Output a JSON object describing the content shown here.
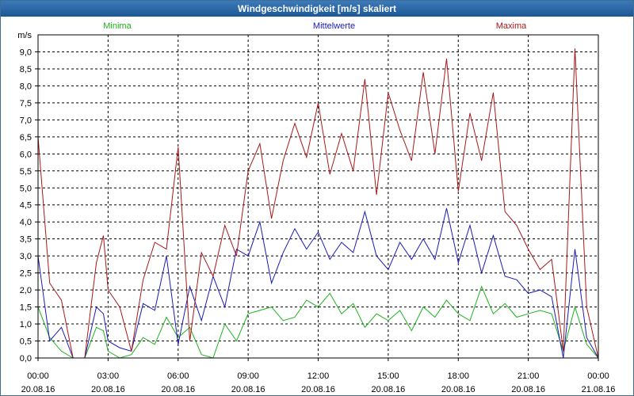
{
  "window": {
    "title": "Windgeschwindigkeit [m/s] skaliert"
  },
  "chart_data": {
    "type": "line",
    "title": "Windgeschwindigkeit [m/s] skaliert",
    "ylabel": "m/s",
    "xlabel": "",
    "ylim": [
      0,
      9.5
    ],
    "xlim": [
      0,
      24
    ],
    "grid": true,
    "legend_placement": "top",
    "yticks": [
      "0,0",
      "0,5",
      "1,0",
      "1,5",
      "2,0",
      "2,5",
      "3,0",
      "3,5",
      "4,0",
      "4,5",
      "5,0",
      "5,5",
      "6,0",
      "6,5",
      "7,0",
      "7,5",
      "8,0",
      "8,5",
      "9,0"
    ],
    "xticks": [
      {
        "time": "00:00",
        "date": "20.08.16"
      },
      {
        "time": "03:00",
        "date": "20.08.16"
      },
      {
        "time": "06:00",
        "date": "20.08.16"
      },
      {
        "time": "09:00",
        "date": "20.08.16"
      },
      {
        "time": "12:00",
        "date": "20.08.16"
      },
      {
        "time": "15:00",
        "date": "20.08.16"
      },
      {
        "time": "18:00",
        "date": "20.08.16"
      },
      {
        "time": "21:00",
        "date": "20.08.16"
      },
      {
        "time": "00:00",
        "date": "21.08.16"
      }
    ],
    "series": [
      {
        "name": "Minima",
        "color": "#1fb21f",
        "x": [
          0,
          0.5,
          1,
          1.5,
          2,
          2.5,
          2.8,
          3,
          3.5,
          4,
          4.5,
          5,
          5.5,
          6,
          6.5,
          7,
          7.5,
          8,
          8.5,
          9,
          9.5,
          10,
          10.5,
          11,
          11.5,
          12,
          12.5,
          13,
          13.5,
          14,
          14.5,
          15,
          15.5,
          16,
          16.5,
          17,
          17.5,
          18,
          18.5,
          19,
          19.5,
          20,
          20.5,
          21,
          21.5,
          22,
          22.5,
          23,
          23.5,
          24
        ],
        "y": [
          1.5,
          0.6,
          0.2,
          0,
          0,
          0.9,
          0.8,
          0.2,
          0,
          0.1,
          0.6,
          0.4,
          1.2,
          0.6,
          0.9,
          0.1,
          0,
          1,
          0.5,
          1.3,
          1.4,
          1.5,
          1.1,
          1.2,
          1.7,
          1.5,
          1.9,
          1.3,
          1.6,
          0.9,
          1.3,
          1.1,
          1.4,
          0.8,
          1.5,
          1.2,
          1.7,
          1.3,
          1.1,
          2.1,
          1.3,
          1.6,
          1.2,
          1.3,
          1.4,
          1.3,
          0.2,
          1.5,
          0.4,
          0
        ]
      },
      {
        "name": "Mittelwerte",
        "color": "#1a1ab8",
        "x": [
          0,
          0.5,
          1,
          1.5,
          2,
          2.5,
          2.8,
          3,
          3.5,
          4,
          4.5,
          5,
          5.5,
          6,
          6.5,
          7,
          7.5,
          8,
          8.5,
          9,
          9.5,
          10,
          10.5,
          11,
          11.5,
          12,
          12.5,
          13,
          13.5,
          14,
          14.5,
          15,
          15.5,
          16,
          16.5,
          17,
          17.5,
          18,
          18.5,
          19,
          19.5,
          20,
          20.5,
          21,
          21.5,
          22,
          22.5,
          23,
          23.5,
          24
        ],
        "y": [
          3.0,
          0.5,
          0.9,
          0,
          0,
          1.5,
          1.3,
          0.5,
          0.3,
          0.2,
          1.6,
          1.4,
          3.0,
          0.4,
          2.1,
          1.1,
          2.4,
          1.5,
          3.2,
          3.0,
          4.0,
          2.2,
          3.1,
          3.8,
          3.2,
          3.7,
          2.9,
          3.4,
          3.1,
          4.3,
          3.0,
          2.6,
          3.4,
          2.9,
          3.5,
          2.9,
          4.4,
          2.8,
          3.9,
          2.5,
          3.6,
          2.4,
          2.3,
          1.9,
          2.0,
          1.8,
          0,
          3.2,
          0.6,
          0
        ]
      },
      {
        "name": "Maxima",
        "color": "#a81818",
        "x": [
          0,
          0.5,
          1,
          1.5,
          2,
          2.5,
          2.8,
          3,
          3.5,
          4,
          4.5,
          5,
          5.5,
          6,
          6.5,
          7,
          7.5,
          8,
          8.5,
          9,
          9.5,
          10,
          10.5,
          11,
          11.5,
          12,
          12.5,
          13,
          13.5,
          14,
          14.5,
          15,
          15.5,
          16,
          16.5,
          17,
          17.5,
          18,
          18.5,
          19,
          19.5,
          20,
          20.5,
          21,
          21.5,
          22,
          22.5,
          23,
          23.5,
          24
        ],
        "y": [
          6.5,
          2.2,
          1.7,
          0,
          0,
          2.8,
          3.6,
          2.0,
          1.5,
          0.2,
          2.3,
          3.4,
          3.2,
          6.2,
          0.5,
          3.1,
          2.4,
          3.9,
          3.0,
          5.5,
          6.3,
          4.1,
          5.8,
          6.9,
          5.9,
          7.5,
          5.4,
          6.6,
          5.5,
          8.2,
          4.8,
          7.8,
          6.7,
          5.8,
          8.4,
          6.0,
          8.8,
          4.9,
          7.2,
          5.8,
          7.8,
          4.3,
          3.9,
          3.2,
          2.6,
          2.9,
          0.2,
          9.1,
          1.5,
          0
        ]
      }
    ]
  }
}
